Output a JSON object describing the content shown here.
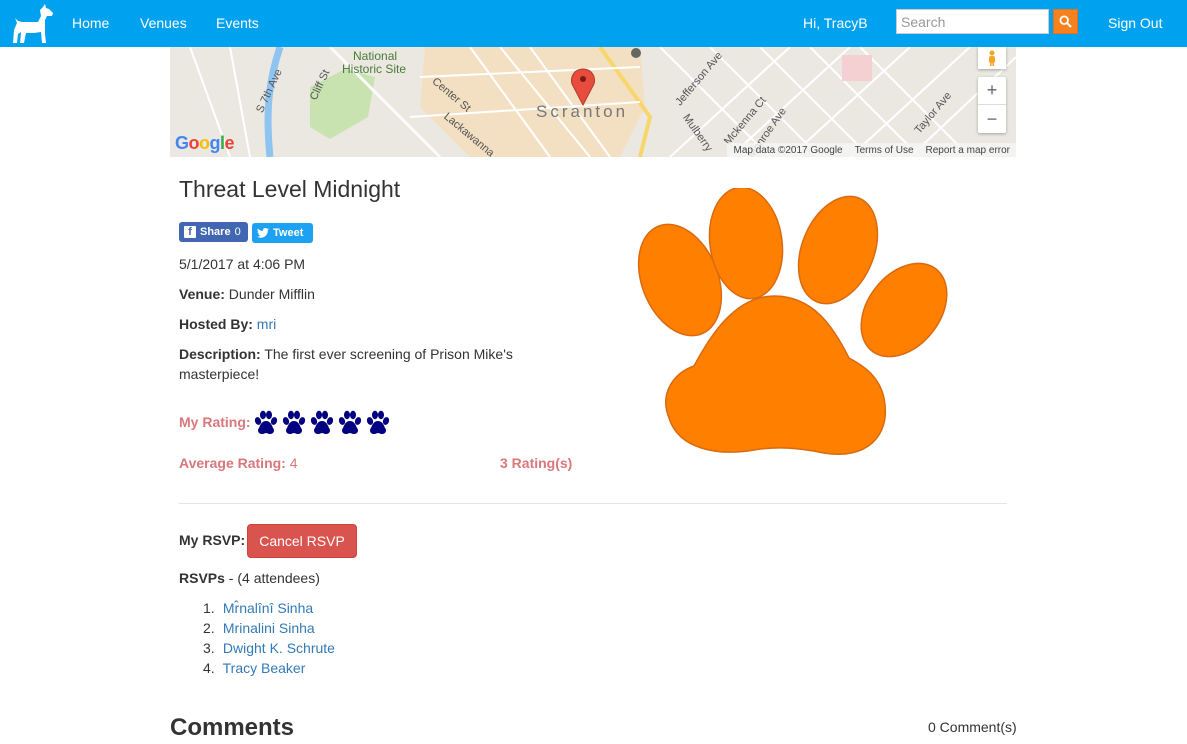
{
  "nav": {
    "logo_icon": "dog-icon",
    "home": "Home",
    "venues": "Venues",
    "events": "Events",
    "greeting": "Hi, TracyB",
    "search_placeholder": "Search",
    "search_icon": "search-icon",
    "signout": "Sign Out",
    "bg_color": "#00a2f0",
    "search_button_color": "#f5821f"
  },
  "map": {
    "labels": {
      "historic": "National",
      "historic2": "Historic Site",
      "city": "Scranton",
      "s7th": "S 7th Ave",
      "cliff": "Cliff St",
      "center": "Center St",
      "lackawanna": "Lackawanna",
      "jefferson": "Jefferson Ave",
      "mckenna": "Mckenna Ct",
      "mulberry": "Mulberry",
      "taylor": "Taylor Ave",
      "monroe": "Monroe Ave"
    },
    "google": "Google",
    "attribution": "Map data ©2017 Google",
    "terms": "Terms of Use",
    "report": "Report a map error",
    "zoom_in": "+",
    "zoom_out": "−"
  },
  "event": {
    "title": "Threat Level Midnight",
    "share_label": "Share",
    "share_count": "0",
    "tweet_label": "Tweet",
    "datetime": "5/1/2017 at 4:06 PM",
    "venue_label": "Venue:",
    "venue": "Dunder Mifflin",
    "host_label": "Hosted By:",
    "host": "mri",
    "description_label": "Description:",
    "description": "The first ever screening of Prison Mike's masterpiece!",
    "my_rating_label": "My Rating:",
    "my_rating": 5,
    "rating_max": 5,
    "avg_label": "Average Rating:",
    "avg_value": "4",
    "ratings_count": "3 Rating(s)",
    "rating_color": "#d9777b",
    "paw_color": "#000080",
    "big_paw_color": "#ff7f00"
  },
  "rsvp": {
    "my_label": "My RSVP:",
    "cancel_label": "Cancel RSVP",
    "rsvps_label": "RSVPs",
    "attendees_text": " - (4 attendees)",
    "attendees": [
      {
        "num": "1.",
        "name": "Mr̂nalînî Sinha"
      },
      {
        "num": "2.",
        "name": "Mrinalini Sinha"
      },
      {
        "num": "3.",
        "name": "Dwight K. Schrute"
      },
      {
        "num": "4.",
        "name": "Tracy Beaker"
      }
    ]
  },
  "comments": {
    "heading": "Comments",
    "count": "0 Comment(s)"
  }
}
